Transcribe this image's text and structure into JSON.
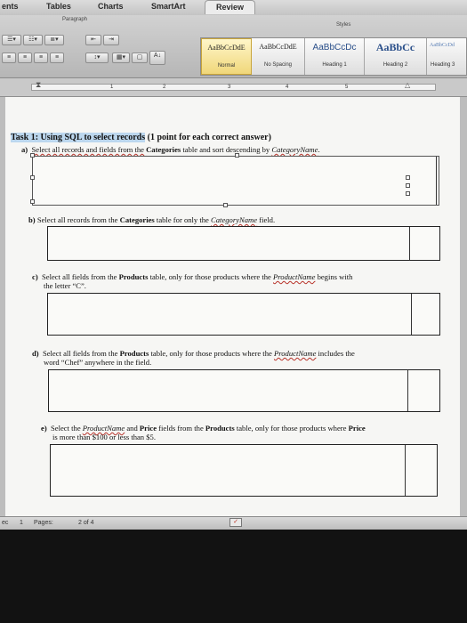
{
  "ribbon": {
    "tabs": [
      {
        "label": "ents"
      },
      {
        "label": "Tables"
      },
      {
        "label": "Charts"
      },
      {
        "label": "SmartArt"
      },
      {
        "label": "Review"
      }
    ],
    "groups": {
      "paragraph": "Paragraph",
      "styles": "Styles"
    },
    "styles": [
      {
        "sample": "AaBbCcDdE",
        "name": "Normal"
      },
      {
        "sample": "AaBbCcDdE",
        "name": "No Spacing"
      },
      {
        "sample": "AaBbCcDc",
        "name": "Heading 1"
      },
      {
        "sample": "AaBbCc",
        "name": "Heading 2"
      },
      {
        "sample": "AaBbCcDd",
        "name": "Heading 3"
      }
    ]
  },
  "ruler": {
    "numbers": [
      "1",
      "2",
      "3",
      "4",
      "5"
    ]
  },
  "document": {
    "task_title": "Task 1: Using SQL to select records",
    "task_points": " (1 point for each correct answer)",
    "q_a": {
      "label": "a)",
      "t1": "Select all records and fields from the ",
      "b1": "Categories",
      "t2": " table and sort descending by ",
      "u1": "CategoryName",
      "t3": "."
    },
    "q_b": {
      "label": "b)",
      "t1": "Select all records from the ",
      "b1": "Categories",
      "t2": " table for only the ",
      "u1": "CategoryName",
      "t3": " field."
    },
    "q_c": {
      "label": "c)",
      "t1": "Select all fields from the ",
      "b1": "Products",
      "t2": " table, only for those products where the ",
      "u1": "ProductName",
      "t3": " begins with",
      "line2": "the letter “C”."
    },
    "q_d": {
      "label": "d)",
      "t1": "Select all fields from the ",
      "b1": "Products",
      "t2": " table, only for those products where the ",
      "u1": "ProductName",
      "t3": " includes the",
      "line2": "word “Chef” anywhere in the field."
    },
    "q_e": {
      "label": "e)",
      "t1": "Select the ",
      "u1": "ProductName",
      "t2": " and ",
      "b1": "Price",
      "t3": " fields from the ",
      "b2": "Products",
      "t4": " table, only for those products where ",
      "b3": "Price",
      "line2": "is more than $100 or less than $5."
    }
  },
  "status": {
    "section": "ec",
    "section_no": "1",
    "pages_label": "Pages:",
    "pages_value": "2 of 4"
  }
}
